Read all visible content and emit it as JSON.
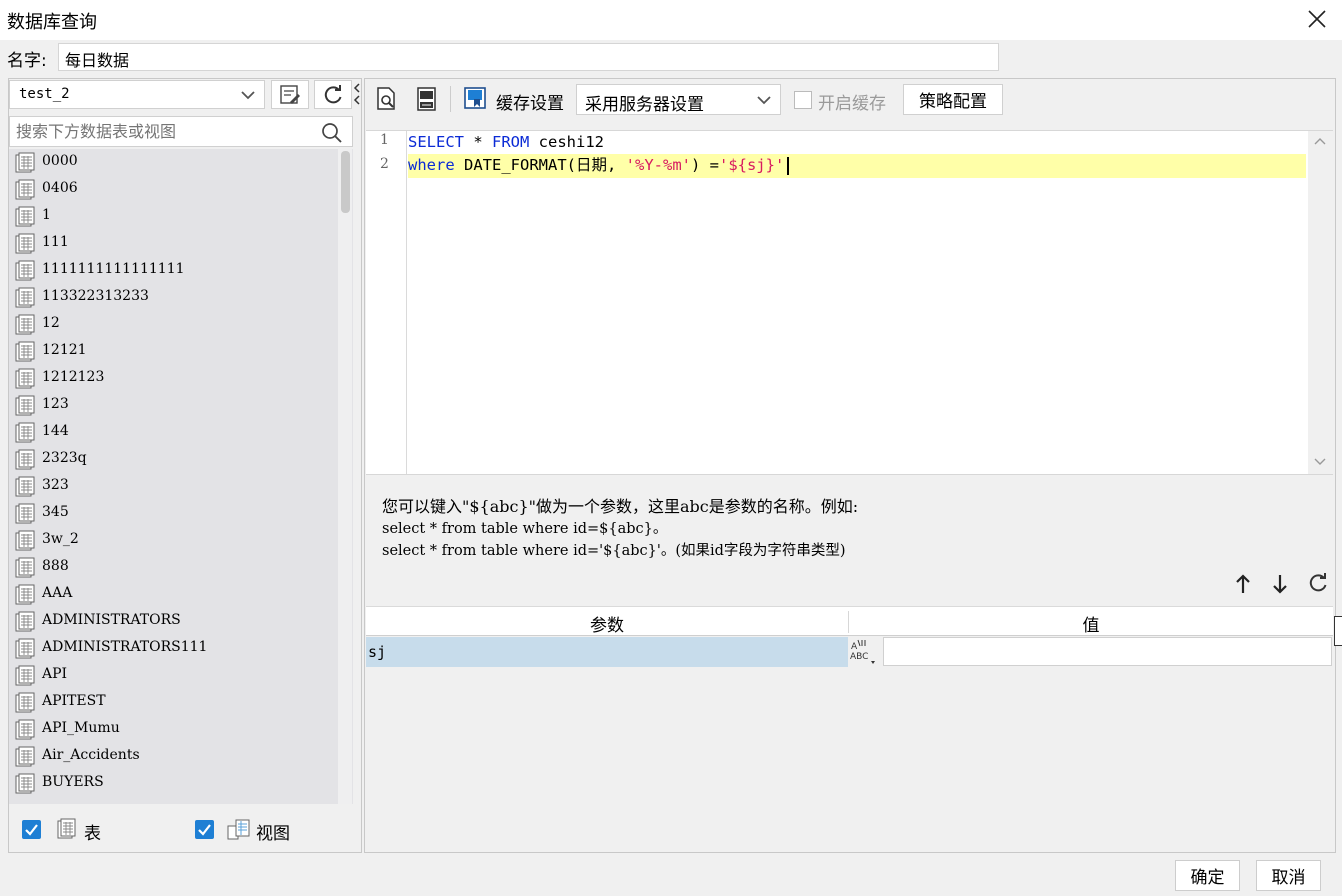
{
  "window": {
    "title": "数据库查询",
    "close_icon": "close-icon"
  },
  "name_field": {
    "label": "名字:",
    "value": "每日数据"
  },
  "left": {
    "db_select": "test_2",
    "search_placeholder": "搜索下方数据表或视图",
    "tables": [
      "0000",
      "0406",
      "1",
      "111",
      "1111111111111111",
      "113322313233",
      "12",
      "12121",
      "1212123",
      "123",
      "144",
      "2323q",
      "323",
      "345",
      "3w_2",
      "888",
      "AAA",
      "ADMINISTRATORS",
      "ADMINISTRATORS111",
      "API",
      "APITEST",
      "API_Mumu",
      "Air_Accidents",
      "BUYERS"
    ],
    "filter_table_label": "表",
    "filter_view_label": "视图"
  },
  "toolbar": {
    "cache_label": "缓存设置",
    "cache_select": "采用服务器设置",
    "enable_cache_label": "开启缓存",
    "strategy_button": "策略配置"
  },
  "editor": {
    "line_numbers": [
      "1",
      "2"
    ],
    "line1": {
      "kw1": "SELECT",
      "mid": " * ",
      "kw2": "FROM",
      "rest": " ceshi12"
    },
    "line2": {
      "kw1": "where",
      "fn": " DATE_FORMAT(日期, ",
      "s1": "'%Y-%m'",
      "mid": ") =",
      "s2": "'${sj}'"
    }
  },
  "hint": {
    "line1": "您可以键入\"${abc}\"做为一个参数，这里abc是参数的名称。例如:",
    "line2": "select * from table where id=${abc}。",
    "line3": "select * from table where id='${abc}'。(如果id字段为字符串类型)"
  },
  "params": {
    "header_param": "参数",
    "header_value": "值",
    "rows": [
      {
        "name": "sj",
        "value": ""
      }
    ]
  },
  "footer": {
    "ok": "确定",
    "cancel": "取消"
  },
  "colors": {
    "accent": "#1e7fd4",
    "keyword": "#0b2bd6",
    "string": "#d81b60",
    "highlight_line": "#ffffa8",
    "selected_row": "#c7dceb"
  }
}
